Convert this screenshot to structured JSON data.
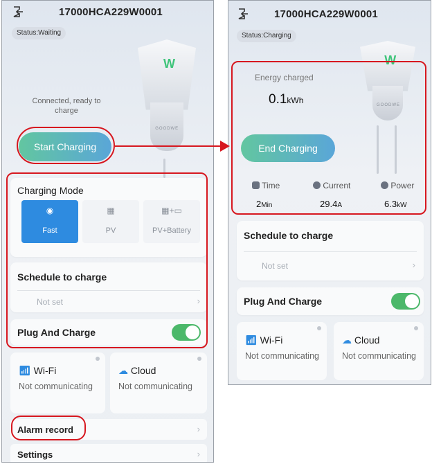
{
  "left": {
    "title": "17000HCA229W0001",
    "status": "Status:Waiting",
    "connected_text": "Connected, ready to charge",
    "start_button": "Start Charging",
    "charger_brand": "GOODWE",
    "charger_logo": "W",
    "charging_mode": {
      "title": "Charging Mode",
      "options": [
        {
          "label": "Fast",
          "icon": "power-icon",
          "selected": true
        },
        {
          "label": "PV",
          "icon": "solar-panel-icon",
          "selected": false
        },
        {
          "label": "PV+Battery",
          "icon": "solar-battery-icon",
          "selected": false
        }
      ]
    },
    "schedule": {
      "title": "Schedule to charge",
      "value": "Not set"
    },
    "plug_and_charge": {
      "label": "Plug And Charge",
      "enabled": true
    },
    "wifi": {
      "name": "Wi-Fi",
      "state": "Not communicating"
    },
    "cloud": {
      "name": "Cloud",
      "state": "Not communicating"
    },
    "alarm_record": "Alarm record",
    "settings": "Settings"
  },
  "right": {
    "title": "17000HCA229W0001",
    "status": "Status:Charging",
    "energy_label": "Energy charged",
    "energy_value": "0.1",
    "energy_unit": "kWh",
    "end_button": "End Charging",
    "charger_brand": "GOODWE",
    "charger_logo": "W",
    "stats": [
      {
        "label": "Time",
        "value": "2",
        "unit": "Min",
        "icon": "clock-icon"
      },
      {
        "label": "Current",
        "value": "29.4",
        "unit": "A",
        "icon": "current-icon"
      },
      {
        "label": "Power",
        "value": "6.3",
        "unit": "kW",
        "icon": "power-icon"
      }
    ],
    "schedule": {
      "title": "Schedule to charge",
      "value": "Not set"
    },
    "plug_and_charge": {
      "label": "Plug And Charge",
      "enabled": true
    },
    "wifi": {
      "name": "Wi-Fi",
      "state": "Not communicating"
    },
    "cloud": {
      "name": "Cloud",
      "state": "Not communicating"
    }
  },
  "colors": {
    "highlight": "#d7171f",
    "accent_blue": "#2e8be0",
    "toggle_green": "#4cb86a",
    "button_gradient_start": "#62c6a0",
    "button_gradient_end": "#5aa6d8"
  }
}
